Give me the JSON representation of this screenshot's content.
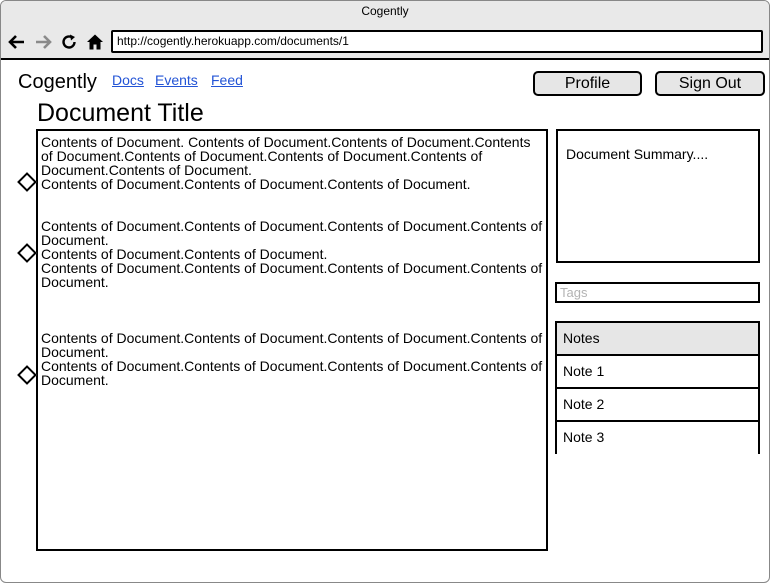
{
  "window": {
    "title": "Cogently"
  },
  "browser": {
    "url": "http://cogently.herokuapp.com/documents/1",
    "icons": [
      "back-arrow-icon",
      "forward-arrow-icon",
      "reload-icon",
      "home-icon"
    ]
  },
  "header": {
    "brand": "Cogently",
    "nav": [
      "Docs",
      "Events",
      "Feed"
    ],
    "profile_label": "Profile",
    "signout_label": "Sign Out"
  },
  "document": {
    "title": "Document Title",
    "paragraphs": [
      [
        "Contents of Document. Contents of Document.Contents of Document.Contents of Document.Contents of Document.Contents of Document.Contents of Document.Contents of Document.",
        "Contents of Document.Contents of Document.Contents of Document."
      ],
      [
        "Contents of Document.Contents of Document.Contents of Document.Contents of Document.",
        "Contents of Document.Contents of Document.",
        "Contents of Document.Contents of Document.Contents of Document.Contents of Document."
      ],
      [
        "Contents of Document.Contents of Document.Contents of Document.Contents of Document.",
        "Contents of Document.Contents of Document.Contents of Document.Contents of Document."
      ]
    ]
  },
  "sidebar": {
    "summary": "Document Summary....",
    "tags_placeholder": "Tags",
    "notes_header": "Notes",
    "notes": [
      "Note 1",
      "Note 2",
      "Note 3"
    ]
  },
  "colors": {
    "link": "#2354d6",
    "chrome": "#e9e9e9",
    "button": "#e6e6e6"
  }
}
